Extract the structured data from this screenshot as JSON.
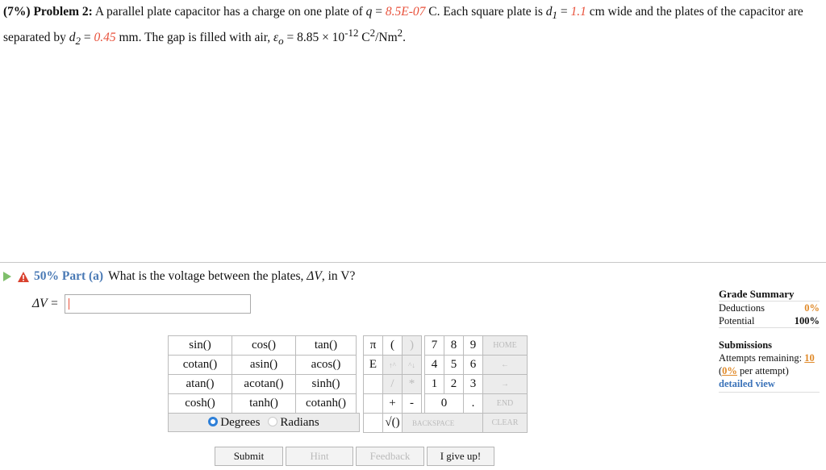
{
  "problem": {
    "weight": "(7%)",
    "title": "Problem 2:",
    "text1": "A parallel plate capacitor has a charge on one plate of",
    "q_var": "q",
    "eq": "=",
    "q_val": "8.5E-07",
    "text2": "C. Each square plate is",
    "d1_var": "d",
    "d1_sub": "1",
    "d1_val": "1.1",
    "text3": "cm wide and the plates of the capacitor are separated by",
    "d2_var": "d",
    "d2_sub": "2",
    "d2_val": "0.45",
    "text4": "mm. The gap is filled with air,",
    "eps_var": "ε",
    "eps_sub": "o",
    "text5": "= 8.85 × 10",
    "eps_exp": "-12",
    "text6": "C",
    "c_exp": "2",
    "text7": "/Nm",
    "m_exp": "2",
    "text8": "."
  },
  "part": {
    "percent": "50% Part (a)",
    "question": "What is the voltage between the plates,",
    "q_var": "ΔV",
    "q_unit": ", in V?",
    "answer_label": "ΔV =",
    "answer_value": ""
  },
  "functions": [
    [
      "sin()",
      "cos()",
      "tan()"
    ],
    [
      "cotan()",
      "asin()",
      "acos()"
    ],
    [
      "atan()",
      "acotan()",
      "sinh()"
    ],
    [
      "cosh()",
      "tanh()",
      "cotanh()"
    ]
  ],
  "modes": {
    "degrees": "Degrees",
    "radians": "Radians",
    "selected": "Degrees"
  },
  "keypad": {
    "pi": "π",
    "lparen": "(",
    "rparen": ")",
    "e": "E",
    "up": "↑^",
    "upsym": "^↓",
    "star": "*",
    "slash": "/",
    "plus": "+",
    "minus": "-",
    "sqrt": "√()",
    "digits": [
      "7",
      "8",
      "9",
      "4",
      "5",
      "6",
      "1",
      "2",
      "3",
      "0",
      "."
    ],
    "home": "HOME",
    "left": "←",
    "right": "→",
    "end": "END",
    "backspace": "BACKSPACE",
    "del": "DEL",
    "clear": "CLEAR"
  },
  "buttons": {
    "submit": "Submit",
    "hint": "Hint",
    "feedback": "Feedback",
    "give_up": "I give up!"
  },
  "grade": {
    "title": "Grade Summary",
    "deductions_label": "Deductions",
    "deductions_val": "0%",
    "potential_label": "Potential",
    "potential_val": "100%",
    "submissions_title": "Submissions",
    "attempts_label": "Attempts remaining:",
    "attempts_val": "10",
    "per_attempt_pct": "0%",
    "per_attempt_text": "per attempt)",
    "detailed": "detailed view"
  },
  "colors": {
    "accent": "#e8513b",
    "link": "#3b73b9",
    "radio": "#2d7fd8"
  }
}
